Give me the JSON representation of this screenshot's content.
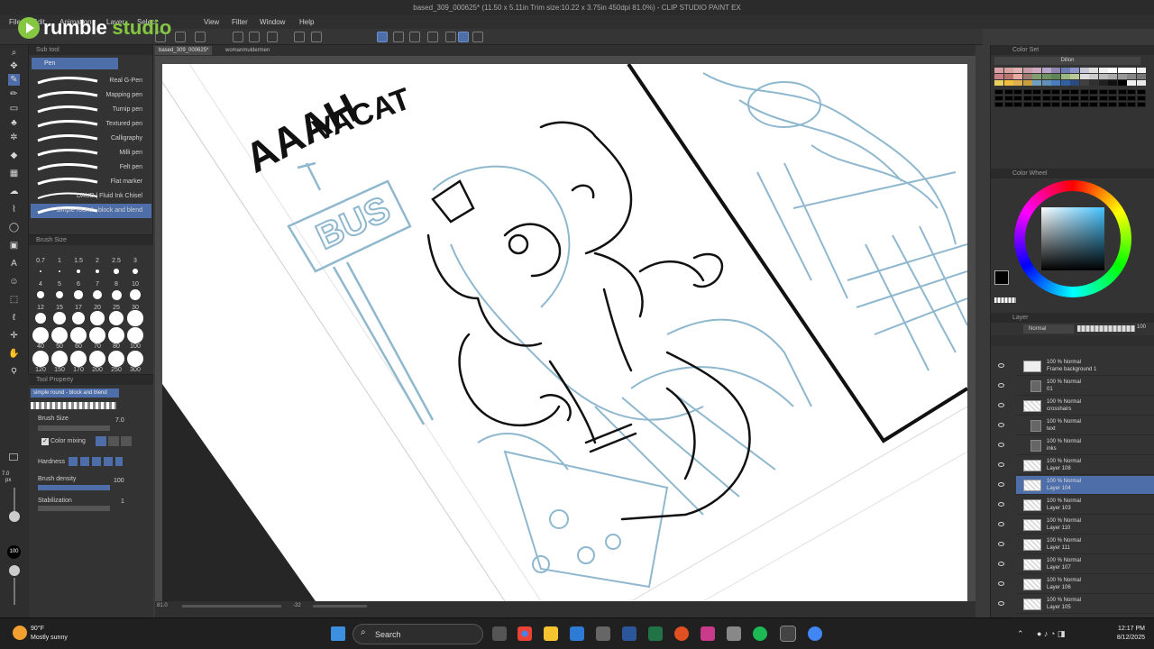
{
  "app": {
    "title": "based_309_000625* (11.50 x 5.11in Trim size:10.22 x 3.75in 450dpi 81.0%) - CLIP STUDIO PAINT EX",
    "watermark_brand": "rumble",
    "watermark_suffix": "studio"
  },
  "menu": [
    "File",
    "Edit",
    "Animation",
    "Layer",
    "Select",
    "View",
    "Filter",
    "Window",
    "Help"
  ],
  "doc_tabs": [
    "based_309_000625*",
    "womanmuldermen"
  ],
  "subtool": {
    "panel_title": "Sub tool",
    "active_tab": "Pen",
    "brushes": [
      {
        "name": "Real G-Pen"
      },
      {
        "name": "Mapping pen"
      },
      {
        "name": "Turnip pen"
      },
      {
        "name": "Textured pen"
      },
      {
        "name": "Calligraphy"
      },
      {
        "name": "Milli pen"
      },
      {
        "name": "Felt pen"
      },
      {
        "name": "Flat marker"
      },
      {
        "name": "DAUB | Fluid Ink Chisel"
      },
      {
        "name": "simple round - block and blend"
      }
    ]
  },
  "brush_size": {
    "panel_title": "Brush Size",
    "sizes": [
      "0.7",
      "1",
      "1.5",
      "2",
      "2.5",
      "3",
      "4",
      "5",
      "6",
      "7",
      "8",
      "10",
      "12",
      "15",
      "17",
      "20",
      "25",
      "30",
      "40",
      "50",
      "60",
      "70",
      "80",
      "100",
      "120",
      "150",
      "170",
      "200",
      "250",
      "300"
    ]
  },
  "tool_property": {
    "panel_title": "Tool Property",
    "preset_name": "simple round - block and blend",
    "brush_size_label": "Brush Size",
    "brush_size_value": "7.0",
    "color_mixing_label": "Color mixing",
    "hardness_label": "Hardness",
    "brush_density_label": "Brush density",
    "brush_density_value": "100",
    "stabilization_label": "Stabilization",
    "stabilization_value": "1",
    "left_size_value": "7.0",
    "left_size_unit": "px",
    "opacity_value": "100"
  },
  "color_set": {
    "panel_title": "Color Set",
    "set_name": "Dillon"
  },
  "color_wheel": {
    "panel_title": "Color Wheel"
  },
  "layer": {
    "panel_title": "Layer",
    "blend_mode": "Normal",
    "opacity": "100",
    "rows": [
      {
        "line1": "100 % Normal",
        "line2": "Frame background 1",
        "kind": "paper"
      },
      {
        "line1": "100 % Normal",
        "line2": "01",
        "kind": "folder"
      },
      {
        "line1": "100 % Normal",
        "line2": "crosshairs",
        "kind": "layer"
      },
      {
        "line1": "100 % Normal",
        "line2": "text",
        "kind": "folder"
      },
      {
        "line1": "100 % Normal",
        "line2": "inks",
        "kind": "folder"
      },
      {
        "line1": "100 % Normal",
        "line2": "Layer 108",
        "kind": "layer"
      },
      {
        "line1": "100 % Normal",
        "line2": "Layer 104",
        "kind": "layer",
        "selected": true
      },
      {
        "line1": "100 % Normal",
        "line2": "Layer 103",
        "kind": "layer"
      },
      {
        "line1": "100 % Normal",
        "line2": "Layer 110",
        "kind": "layer"
      },
      {
        "line1": "100 % Normal",
        "line2": "Layer 111",
        "kind": "layer"
      },
      {
        "line1": "100 % Normal",
        "line2": "Layer 107",
        "kind": "layer"
      },
      {
        "line1": "100 % Normal",
        "line2": "Layer 106",
        "kind": "layer"
      },
      {
        "line1": "100 % Normal",
        "line2": "Layer 105",
        "kind": "layer"
      }
    ]
  },
  "canvas": {
    "art_text_1": "AAAH",
    "art_text_2": "VACAT",
    "sign_text": "BUS",
    "status_zoom": "81.0",
    "status_angle": "-32"
  },
  "taskbar": {
    "weather_temp": "90°F",
    "weather_desc": "Mostly sunny",
    "search_placeholder": "Search",
    "time": "12:17 PM",
    "date": "8/12/2025"
  },
  "colors": {
    "accent": "#4d6ea8",
    "sketch_blue": "#8fb8cf",
    "ink": "#111111",
    "rumble_green": "#85c742"
  }
}
